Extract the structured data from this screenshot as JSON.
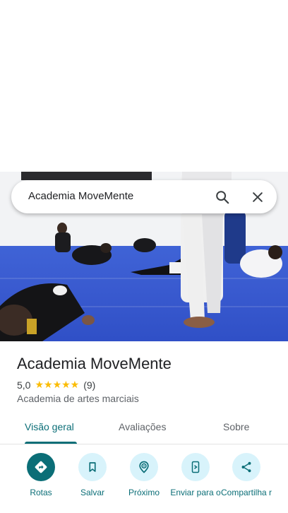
{
  "search": {
    "query": "Academia MoveMente"
  },
  "place": {
    "name": "Academia MoveMente",
    "rating": "5,0",
    "stars": "★★★★★",
    "review_count": "(9)",
    "category": "Academia de artes marciais"
  },
  "tabs": [
    {
      "label": "Visão geral",
      "active": true
    },
    {
      "label": "Avaliações",
      "active": false
    },
    {
      "label": "Sobre",
      "active": false
    }
  ],
  "actions": [
    {
      "label": "Rotas",
      "icon": "directions-icon"
    },
    {
      "label": "Salvar",
      "icon": "bookmark-icon"
    },
    {
      "label": "Próximo",
      "icon": "nearby-icon"
    },
    {
      "label": "Enviar para o",
      "icon": "send-to-phone-icon"
    },
    {
      "label": "Compartilha r",
      "icon": "share-icon"
    }
  ],
  "colors": {
    "accent": "#0b6e77",
    "action_bg": "#d8f3fb",
    "star": "#fbbc04",
    "mat": "#3a5bd0"
  }
}
